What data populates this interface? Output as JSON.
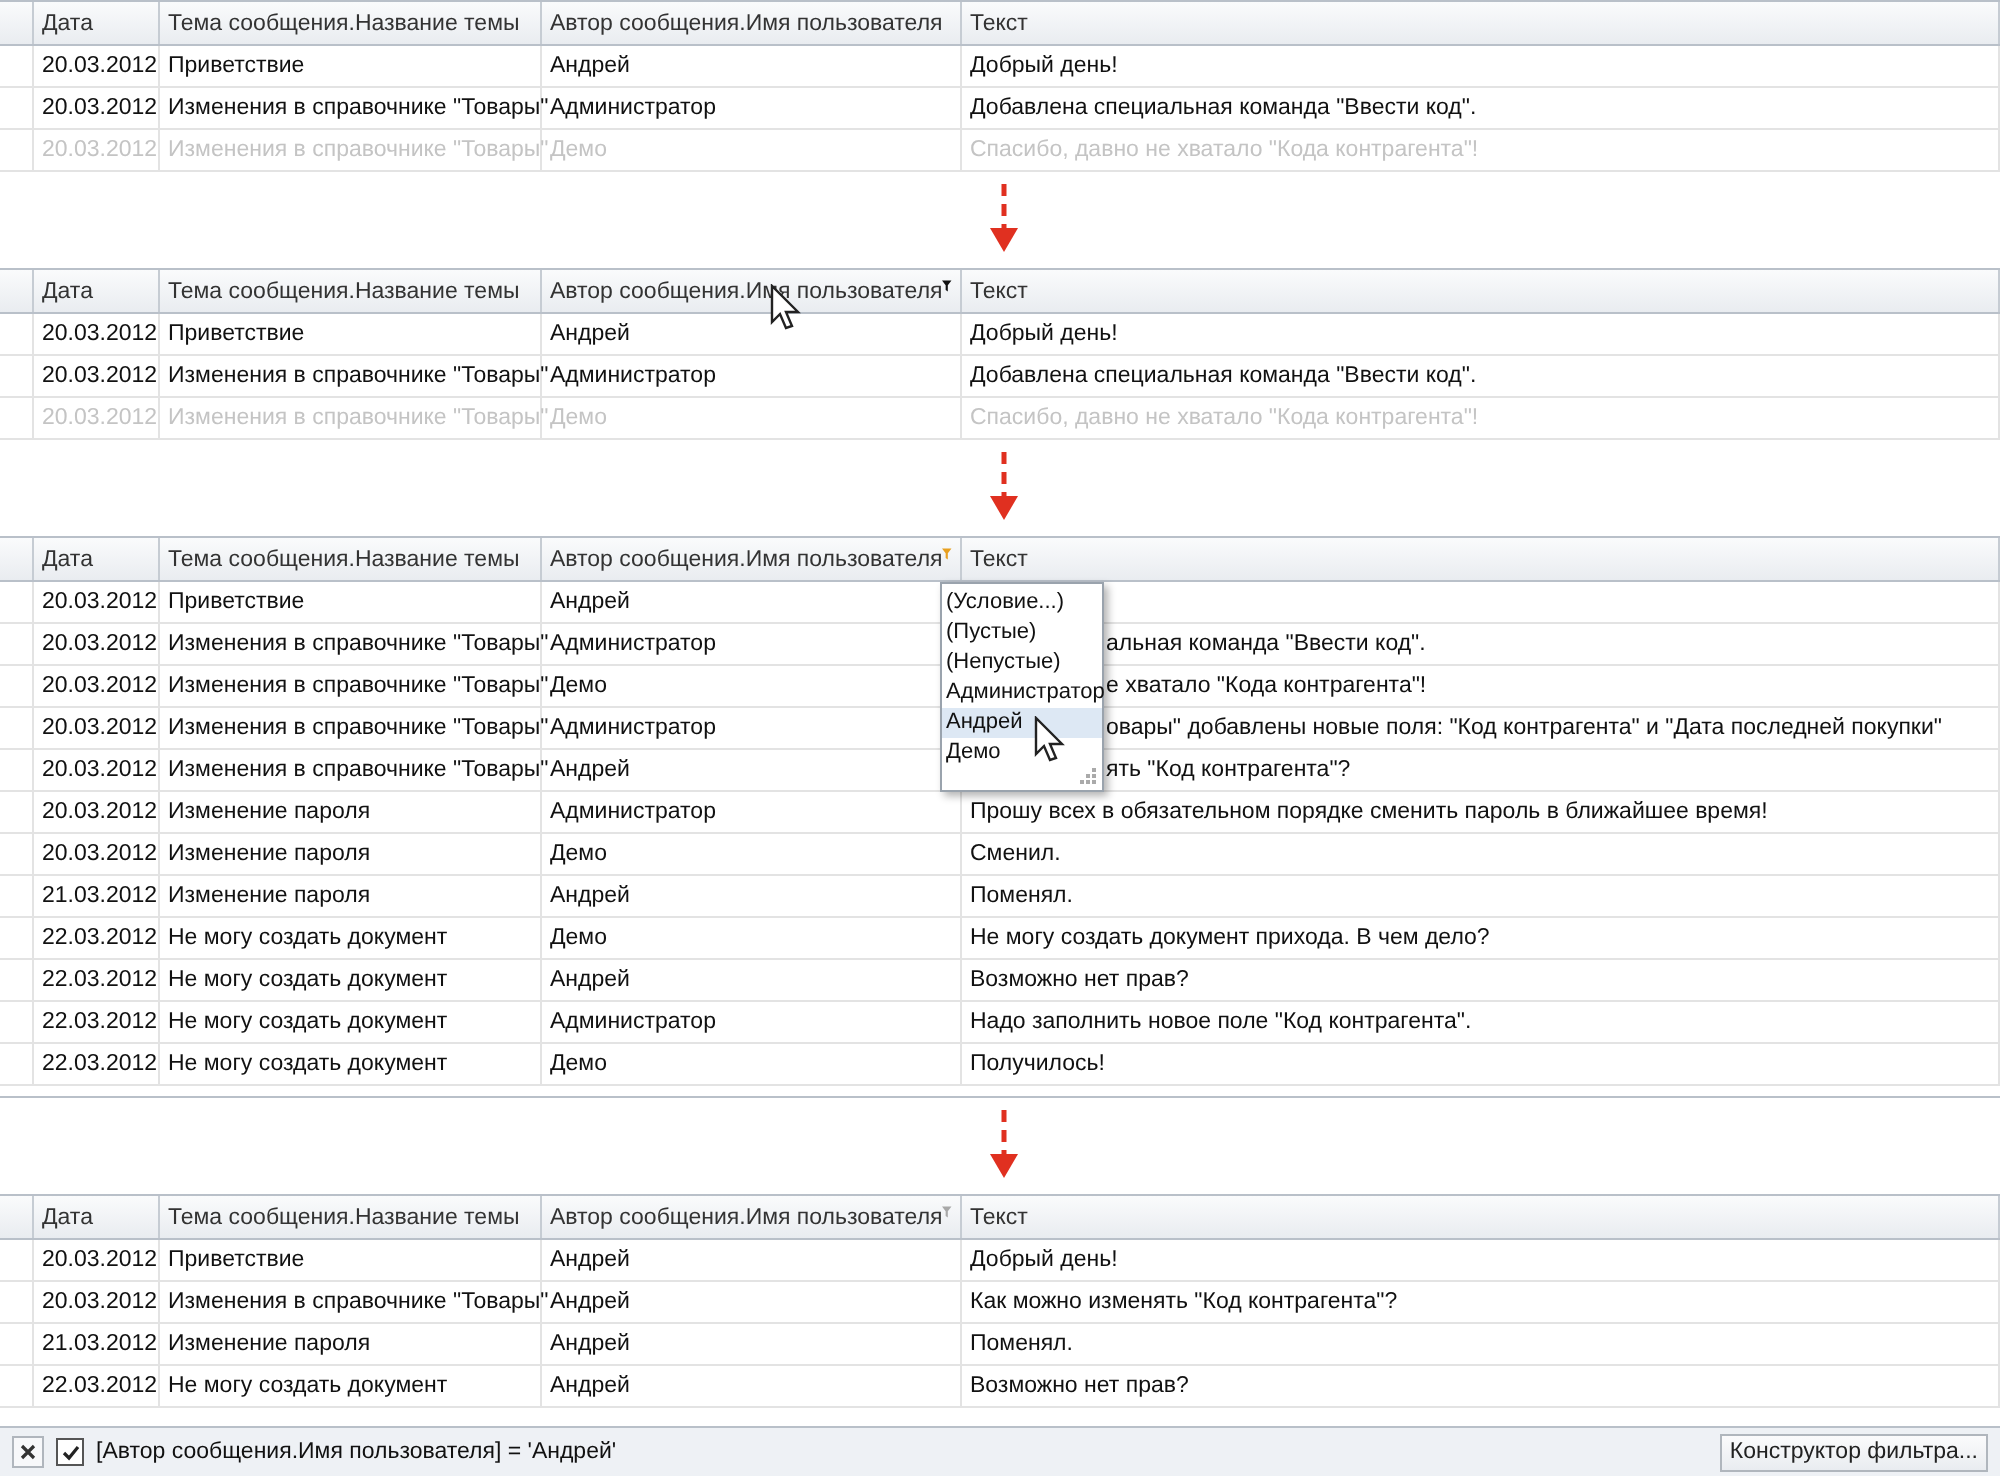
{
  "panels": [
    {
      "columns": [
        {
          "label": "Дата"
        },
        {
          "label": "Тема сообщения.Название темы"
        },
        {
          "label": "Автор сообщения.Имя пользователя"
        },
        {
          "label": "Текст"
        }
      ],
      "rows": [
        {
          "cells": [
            "20.03.2012",
            "Приветствие",
            "Андрей",
            "Добрый день!"
          ],
          "faded": false
        },
        {
          "cells": [
            "20.03.2012",
            "Изменения в справочнике \"Товары\"",
            "Администратор",
            "Добавлена специальная команда \"Ввести код\"."
          ],
          "faded": false
        },
        {
          "cells": [
            "20.03.2012",
            "Изменения в справочнике \"Товары\"",
            "Демо",
            "Спасибо, давно не хватало \"Кода контрагента\"!"
          ],
          "faded": true
        }
      ]
    },
    {
      "columns": [
        {
          "label": "Дата"
        },
        {
          "label": "Тема сообщения.Название темы"
        },
        {
          "label": "Автор сообщения.Имя пользователя",
          "kind": "hover",
          "hovered": true
        },
        {
          "label": "Текст"
        }
      ],
      "rows": [
        {
          "cells": [
            "20.03.2012",
            "Приветствие",
            "Андрей",
            "Добрый день!"
          ],
          "faded": false
        },
        {
          "cells": [
            "20.03.2012",
            "Изменения в справочнике \"Товары\"",
            "Администратор",
            "Добавлена специальная команда \"Ввести код\"."
          ],
          "faded": false
        },
        {
          "cells": [
            "20.03.2012",
            "Изменения в справочнике \"Товары\"",
            "Демо",
            "Спасибо, давно не хватало \"Кода контрагента\"!"
          ],
          "faded": true
        }
      ]
    },
    {
      "columns": [
        {
          "label": "Дата"
        },
        {
          "label": "Тема сообщения.Название темы"
        },
        {
          "label": "Автор сообщения.Имя пользователя",
          "kind": "open"
        },
        {
          "label": "Текст"
        }
      ],
      "rows": [
        {
          "cells": [
            "20.03.2012",
            "Приветствие",
            "Андрей"
          ],
          "faded": false
        },
        {
          "cells": [
            "20.03.2012",
            "Изменения в справочнике \"Товары\"",
            "Администратор",
            "альная команда \"Ввести код\"."
          ],
          "faded": false,
          "covered": true
        },
        {
          "cells": [
            "20.03.2012",
            "Изменения в справочнике \"Товары\"",
            "Демо",
            "е хватало \"Кода контрагента\"!"
          ],
          "faded": false,
          "covered": true
        },
        {
          "cells": [
            "20.03.2012",
            "Изменения в справочнике \"Товары\"",
            "Администратор",
            "овары\" добавлены новые поля: \"Код контрагента\" и \"Дата последней покупки\""
          ],
          "faded": false,
          "covered": true
        },
        {
          "cells": [
            "20.03.2012",
            "Изменения в справочнике \"Товары\"",
            "Андрей",
            "ять \"Код контрагента\"?"
          ],
          "faded": false,
          "covered": true
        },
        {
          "cells": [
            "20.03.2012",
            "Изменение пароля",
            "Администратор",
            "Прошу всех в обязательном порядке сменить пароль в ближайшее время!"
          ],
          "faded": false,
          "covered": false
        },
        {
          "cells": [
            "20.03.2012",
            "Изменение пароля",
            "Демо",
            "Сменил."
          ],
          "faded": false,
          "covered": false
        },
        {
          "cells": [
            "21.03.2012",
            "Изменение пароля",
            "Андрей",
            "Поменял."
          ],
          "faded": false,
          "covered": false
        },
        {
          "cells": [
            "22.03.2012",
            "Не могу создать документ",
            "Демо",
            "Не могу создать документ прихода. В чем дело?"
          ],
          "faded": false,
          "covered": false
        },
        {
          "cells": [
            "22.03.2012",
            "Не могу создать документ",
            "Андрей",
            "Возможно нет прав?"
          ],
          "faded": false,
          "covered": false
        },
        {
          "cells": [
            "22.03.2012",
            "Не могу создать документ",
            "Администратор",
            "Надо заполнить новое поле \"Код контрагента\"."
          ],
          "faded": false,
          "covered": false
        },
        {
          "cells": [
            "22.03.2012",
            "Не могу создать документ",
            "Демо",
            "Получилось!"
          ],
          "faded": false,
          "covered": false
        }
      ],
      "dropdown": {
        "items": [
          {
            "label": "(Условие...)",
            "selected": false
          },
          {
            "label": "(Пустые)",
            "selected": false
          },
          {
            "label": "(Непустые)",
            "selected": false
          },
          {
            "label": "Администратор",
            "selected": false
          },
          {
            "label": "Андрей",
            "selected": true
          },
          {
            "label": "Демо",
            "selected": false
          }
        ]
      }
    },
    {
      "columns": [
        {
          "label": "Дата"
        },
        {
          "label": "Тема сообщения.Название темы"
        },
        {
          "label": "Автор сообщения.Имя пользователя",
          "kind": "filtered"
        },
        {
          "label": "Текст"
        }
      ],
      "rows": [
        {
          "cells": [
            "20.03.2012",
            "Приветствие",
            "Андрей",
            "Добрый день!"
          ],
          "faded": false
        },
        {
          "cells": [
            "20.03.2012",
            "Изменения в справочнике \"Товары\"",
            "Андрей",
            "Как можно изменять \"Код контрагента\"?"
          ],
          "faded": false
        },
        {
          "cells": [
            "21.03.2012",
            "Изменение пароля",
            "Андрей",
            "Поменял."
          ],
          "faded": false
        },
        {
          "cells": [
            "22.03.2012",
            "Не могу создать документ",
            "Андрей",
            "Возможно нет прав?"
          ],
          "faded": false
        }
      ],
      "filter_bar": {
        "checked": true,
        "expression": "[Автор сообщения.Имя пользователя] = 'Андрей'",
        "button": "Конструктор фильтра..."
      }
    }
  ]
}
